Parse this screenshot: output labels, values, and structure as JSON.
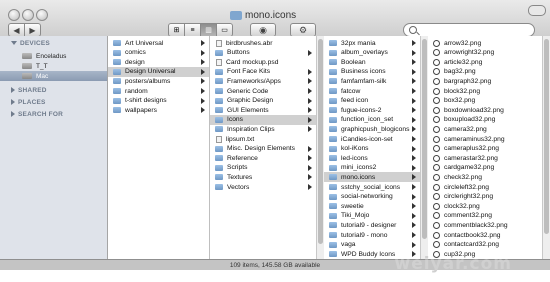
{
  "window": {
    "title": "mono.icons",
    "status": "109 items, 145.58 GB available"
  },
  "sidebar": {
    "devices_label": "DEVICES",
    "devices": [
      "Enceladus",
      "T_T",
      "Mac"
    ],
    "sections": [
      "SHARED",
      "PLACES",
      "SEARCH FOR"
    ]
  },
  "col1": [
    "Art Universal",
    "comics",
    "design",
    "Design Universal",
    "posters/albums",
    "random",
    "t-shirt designs",
    "wallpapers"
  ],
  "col2": [
    "birdbrushes.abr",
    "Buttons",
    "Card mockup.psd",
    "Font Face Kits",
    "Frameworks/Apps",
    "Generic Code",
    "Graphic Design",
    "GUI Elements",
    "Icons",
    "Inspiration Clips",
    "lipsum.txt",
    "Misc. Design Elements",
    "Reference",
    "Scripts",
    "Textures",
    "Vectors"
  ],
  "col3": [
    "32px mania",
    "album_overlays",
    "Boolean",
    "Business icons",
    "famfamfam-silk",
    "fatcow",
    "feed icon",
    "fugue-icons-2",
    "function_icon_set",
    "graphicpush_blogicons",
    "iCandies-icon-set",
    "kol-iKons",
    "led-icons",
    "mini_icons2",
    "mono.icons",
    "sstchy_social_icons",
    "social-networking",
    "sweetie",
    "Tiki_Mojo",
    "tutorial9 - designer",
    "tutorial9 - mono",
    "vaga",
    "WPD Buddy Icons"
  ],
  "col4": [
    "arrow32.png",
    "arrowright32.png",
    "article32.png",
    "bag32.png",
    "bargraph32.png",
    "block32.png",
    "box32.png",
    "boxdownload32.png",
    "boxupload32.png",
    "camera32.png",
    "cameraminus32.png",
    "cameraplus32.png",
    "camerastar32.png",
    "cardgame32.png",
    "check32.png",
    "circleleft32.png",
    "circleright32.png",
    "clock32.png",
    "comment32.png",
    "commentblack32.png",
    "contactbook32.png",
    "contactcard32.png",
    "cup32.png"
  ],
  "watermark": "weiyar.com"
}
